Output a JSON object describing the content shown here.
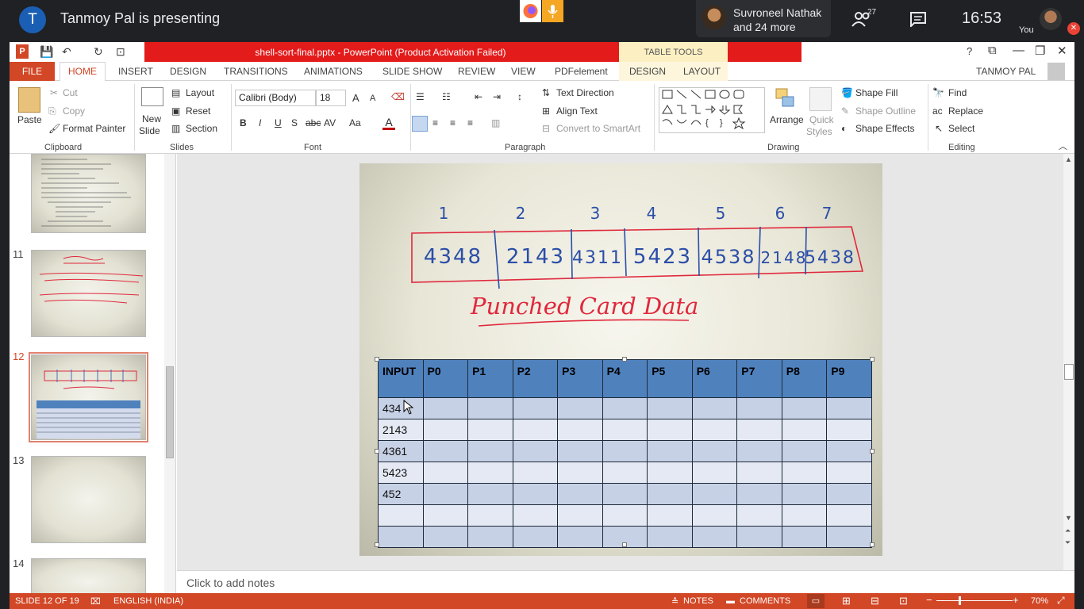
{
  "meet": {
    "avatar_letter": "T",
    "presenting_text": "Tanmoy Pal is presenting",
    "participant_name_line1": "Suvroneel Nathak",
    "participant_name_line2": "and 24 more",
    "participants_count": "27",
    "clock": "16:53",
    "self_label": "You"
  },
  "window": {
    "title": "shell-sort-final.pptx - PowerPoint (Product Activation Failed)",
    "table_tools": "TABLE TOOLS",
    "help": "?",
    "user": "TANMOY PAL"
  },
  "tabs": {
    "file": "FILE",
    "home": "HOME",
    "insert": "INSERT",
    "design": "DESIGN",
    "transitions": "TRANSITIONS",
    "animations": "ANIMATIONS",
    "slideshow": "SLIDE SHOW",
    "review": "REVIEW",
    "view": "VIEW",
    "pdfelement": "PDFelement",
    "tt_design": "DESIGN",
    "tt_layout": "LAYOUT"
  },
  "ribbon": {
    "clipboard": {
      "paste": "Paste",
      "cut": "Cut",
      "copy": "Copy",
      "format_painter": "Format Painter",
      "label": "Clipboard"
    },
    "slides": {
      "new_slide_1": "New",
      "new_slide_2": "Slide",
      "layout": "Layout",
      "reset": "Reset",
      "section": "Section",
      "label": "Slides"
    },
    "font": {
      "font_name": "Calibri (Body)",
      "font_size": "18",
      "bold": "B",
      "italic": "I",
      "underline": "U",
      "shadow": "S",
      "strike": "abc",
      "spacing": "AV",
      "case": "Aa",
      "grow": "A",
      "shrink": "A",
      "label": "Font"
    },
    "paragraph": {
      "text_direction": "Text Direction",
      "align_text": "Align Text",
      "convert_smartart": "Convert to SmartArt",
      "label": "Paragraph"
    },
    "drawing": {
      "arrange": "Arrange",
      "quick_styles_1": "Quick",
      "quick_styles_2": "Styles",
      "shape_fill": "Shape Fill",
      "shape_outline": "Shape Outline",
      "shape_effects": "Shape Effects",
      "label": "Drawing"
    },
    "editing": {
      "find": "Find",
      "replace": "Replace",
      "select": "Select",
      "label": "Editing"
    }
  },
  "slides_pane": {
    "numbers": [
      "11",
      "12",
      "13",
      "14"
    ]
  },
  "slide": {
    "positions": [
      "1",
      "2",
      "3",
      "4",
      "5",
      "6",
      "7"
    ],
    "values": [
      "4348",
      "2143",
      "4311",
      "5423",
      "4538",
      "2148",
      "5438"
    ],
    "handwritten_title": "Punched Card Data",
    "table": {
      "headers": [
        "INPUT",
        "P0",
        "P1",
        "P2",
        "P3",
        "P4",
        "P5",
        "P6",
        "P7",
        "P8",
        "P9"
      ],
      "inputs": [
        "434",
        "2143",
        "4361",
        "5423",
        "452",
        "",
        ""
      ]
    }
  },
  "notes": {
    "placeholder": "Click to add notes"
  },
  "status": {
    "slide": "SLIDE 12 OF 19",
    "language": "ENGLISH (INDIA)",
    "notes": "NOTES",
    "comments": "COMMENTS",
    "zoom": "70%"
  },
  "colors": {
    "ppt_orange": "#d24726",
    "title_red": "#e31b1b",
    "table_header": "#4f81bd",
    "ink_blue": "#2b4ea8",
    "ink_red": "#e0283c"
  }
}
